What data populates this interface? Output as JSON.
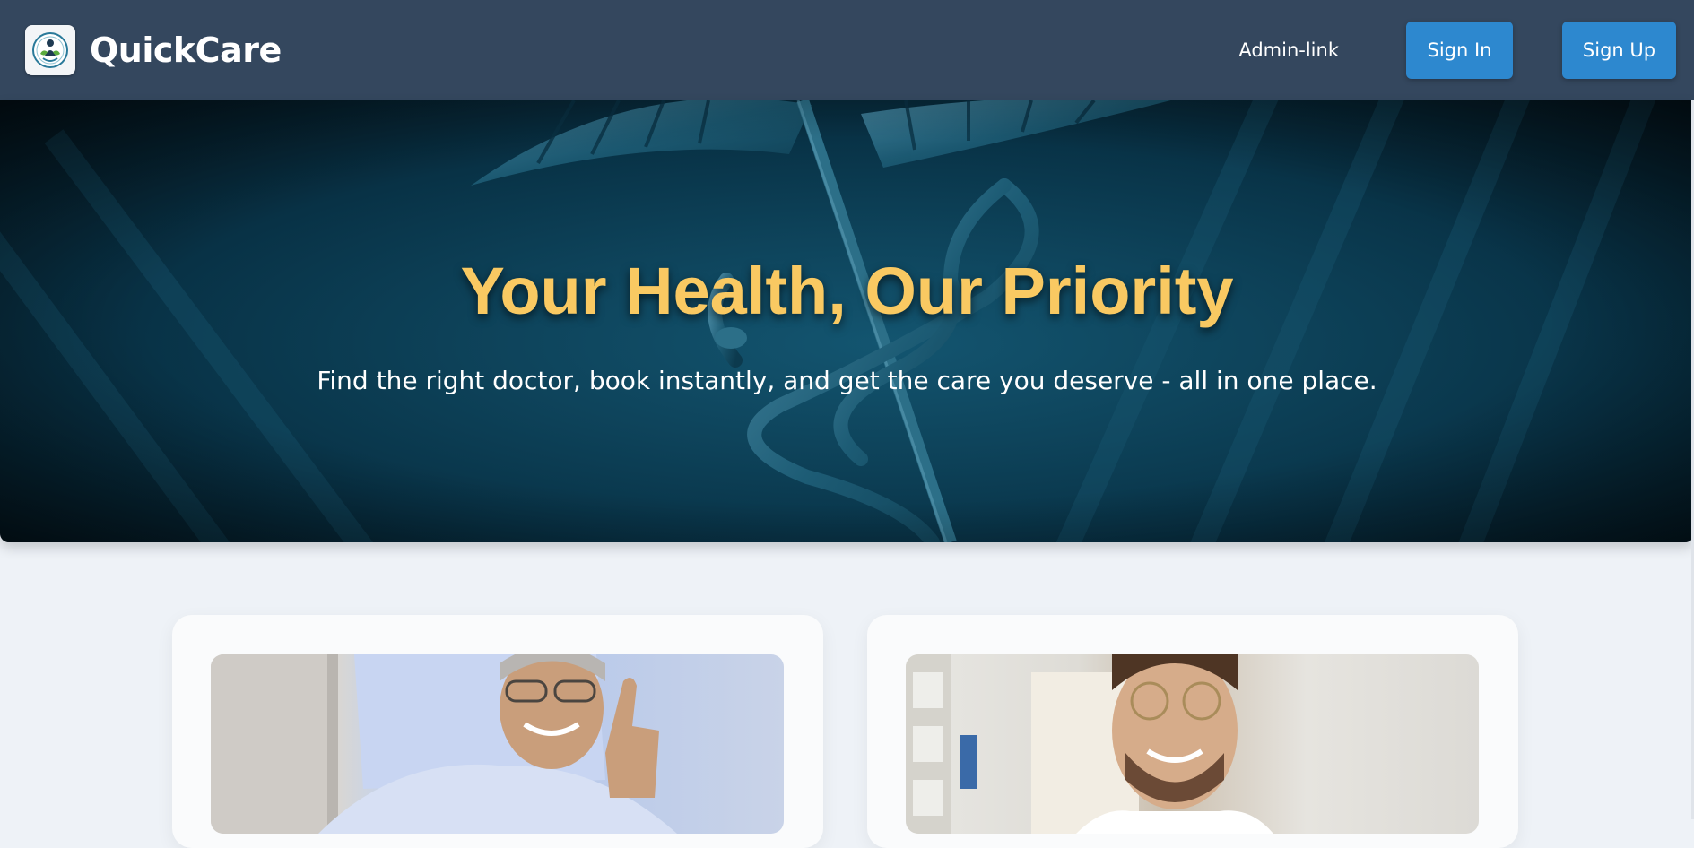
{
  "navbar": {
    "brand_name": "QuickCare",
    "logo_icon": "medical-care-logo-icon",
    "admin_link": "Admin-link",
    "sign_in": "Sign In",
    "sign_up": "Sign Up"
  },
  "hero": {
    "title": "Your Health, Our Priority",
    "subtitle": "Find the right doctor, book instantly, and get the care you deserve - all in one place.",
    "background_icon": "caduceus-icon"
  },
  "cards": [
    {
      "image": "patient-thumbs-up-photo"
    },
    {
      "image": "smiling-doctor-photo"
    }
  ],
  "colors": {
    "navbar_bg": "#34475e",
    "button_bg": "#2d88cf",
    "hero_title": "#f9c962",
    "page_bg": "#eef2f7"
  }
}
